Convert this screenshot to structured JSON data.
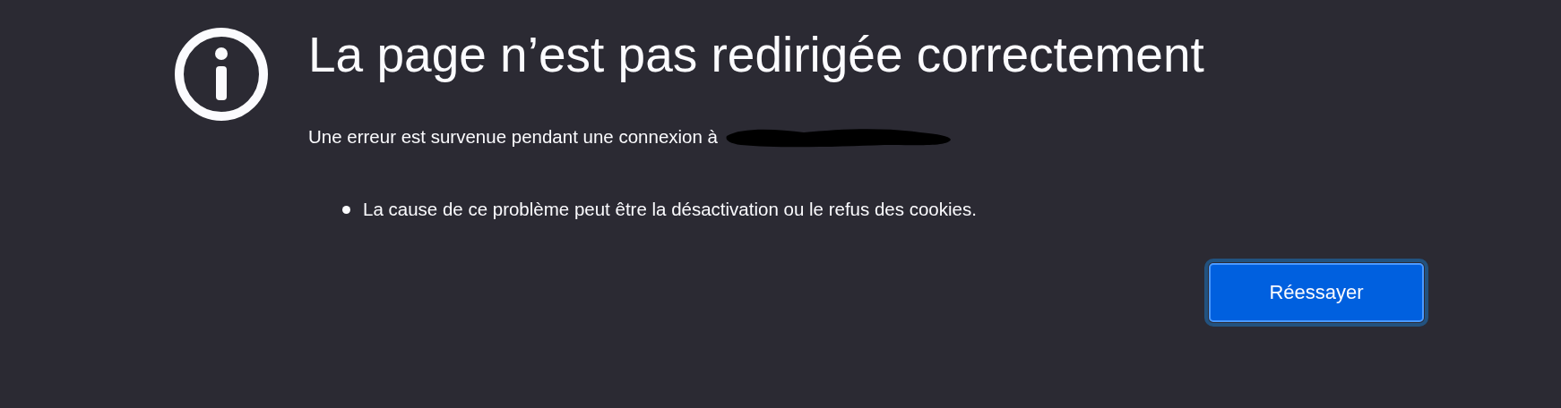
{
  "title": "La page n’est pas redirigée correctement",
  "message": {
    "text": "Une erreur est survenue pendant une connexion à",
    "redacted": true
  },
  "causes": [
    "La cause de ce problème peut être la désactivation ou le refus des cookies."
  ],
  "button": {
    "label": "Réessayer",
    "focused": true
  }
}
